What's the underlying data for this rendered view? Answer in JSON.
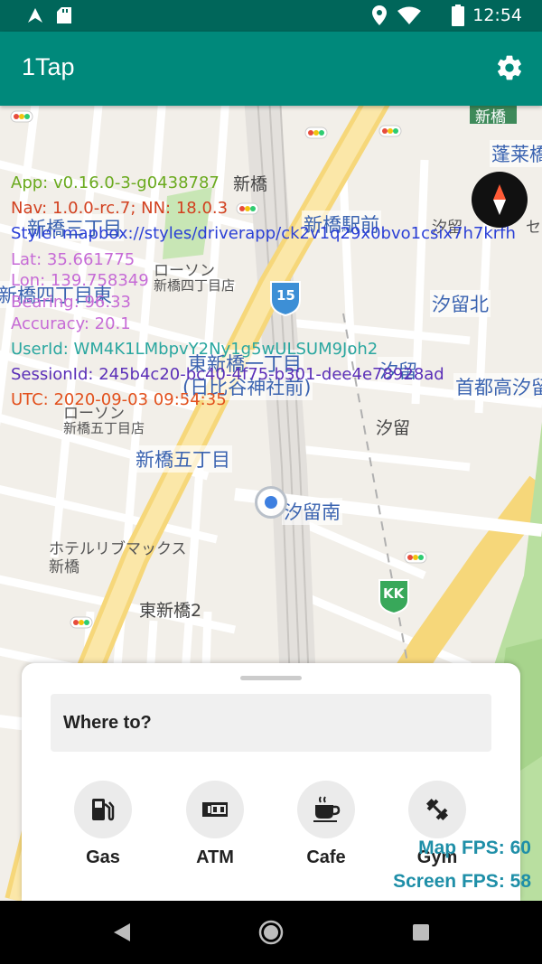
{
  "status_bar": {
    "time": "12:54",
    "icons": [
      "navigation-icon",
      "sd-card-icon",
      "location-icon",
      "wifi-icon",
      "battery-icon"
    ]
  },
  "app_bar": {
    "title": "1Tap",
    "settings_icon": "gear-icon"
  },
  "map": {
    "labels": [
      {
        "id": "shimbashi-top",
        "text": "新橋"
      },
      {
        "id": "shimbashi",
        "text": "新橋"
      },
      {
        "id": "horaibashi",
        "text": "蓬莱橋"
      },
      {
        "id": "shimbashi3",
        "text": "新橋三丁目"
      },
      {
        "id": "shimbashi-station",
        "text": "新橋駅前"
      },
      {
        "id": "shiodome-west",
        "text": "汐留"
      },
      {
        "id": "se",
        "text": "セ"
      },
      {
        "id": "lawson1",
        "text": "ローソン"
      },
      {
        "id": "lawson1-sub",
        "text": "新橋四丁目店"
      },
      {
        "id": "shimbashi4",
        "text": "新橋四丁目東"
      },
      {
        "id": "shiodome-north",
        "text": "汐留北"
      },
      {
        "id": "route15",
        "text": "15"
      },
      {
        "id": "higashi1",
        "text": "東新橋一丁目"
      },
      {
        "id": "hibiya",
        "text": "(日比谷神社前)"
      },
      {
        "id": "shiodome2",
        "text": "汐留"
      },
      {
        "id": "shutoko",
        "text": "首都高汐留"
      },
      {
        "id": "lawson2",
        "text": "ローソン"
      },
      {
        "id": "lawson2-sub",
        "text": "新橋五丁目店"
      },
      {
        "id": "shiodome-station",
        "text": "汐留"
      },
      {
        "id": "shimbashi5",
        "text": "新橋五丁目"
      },
      {
        "id": "shiodome-south",
        "text": "汐留南"
      },
      {
        "id": "hotel",
        "text": "ホテルリブマックス"
      },
      {
        "id": "hotel-sub",
        "text": "新橋"
      },
      {
        "id": "kk",
        "text": "KK"
      },
      {
        "id": "higashishimbashi2",
        "text": "東新橋2"
      }
    ]
  },
  "debug": {
    "app": "App: v0.16.0-3-g0438787",
    "nav": "Nav: 1.0.0-rc.7; NN: 18.0.3",
    "style": "Style: mapbox://styles/driverapp/ck2v1q29x0bvo1csix7h7krfh",
    "lat": "Lat: 35.661775",
    "lon": "Lon: 139.758349",
    "bearing": "Bearing: 96.33",
    "accuracy": "Accuracy: 20.1",
    "user": "UserId: WM4K1LMbpvY2Ny1g5wULSUM9Joh2",
    "session": "SessionId: 245b4c20-bc40-4f75-b301-dee4e78928ad",
    "utc": "UTC: 2020-09-03 09:54:35",
    "colors": {
      "app": "#6aaa1e",
      "nav": "#d2401f",
      "style": "#2a3fd6",
      "lat": "#c66bd6",
      "lon": "#c66bd6",
      "bearing": "#c66bd6",
      "accuracy": "#c66bd6",
      "user": "#2aa7a0",
      "session": "#5b2fb8",
      "utc": "#e2501c"
    }
  },
  "sheet": {
    "search_placeholder": "Where to?",
    "categories": [
      {
        "label": "Gas",
        "icon": "gas-station-icon"
      },
      {
        "label": "ATM",
        "icon": "atm-icon"
      },
      {
        "label": "Cafe",
        "icon": "coffee-icon"
      },
      {
        "label": "Gym",
        "icon": "dumbbell-icon"
      }
    ]
  },
  "fps": {
    "map": "Map FPS: 60",
    "screen": "Screen FPS: 58"
  },
  "colors": {
    "primary": "#00897b",
    "status_bar": "#00665a",
    "fps_text": "#1f8fa8"
  }
}
